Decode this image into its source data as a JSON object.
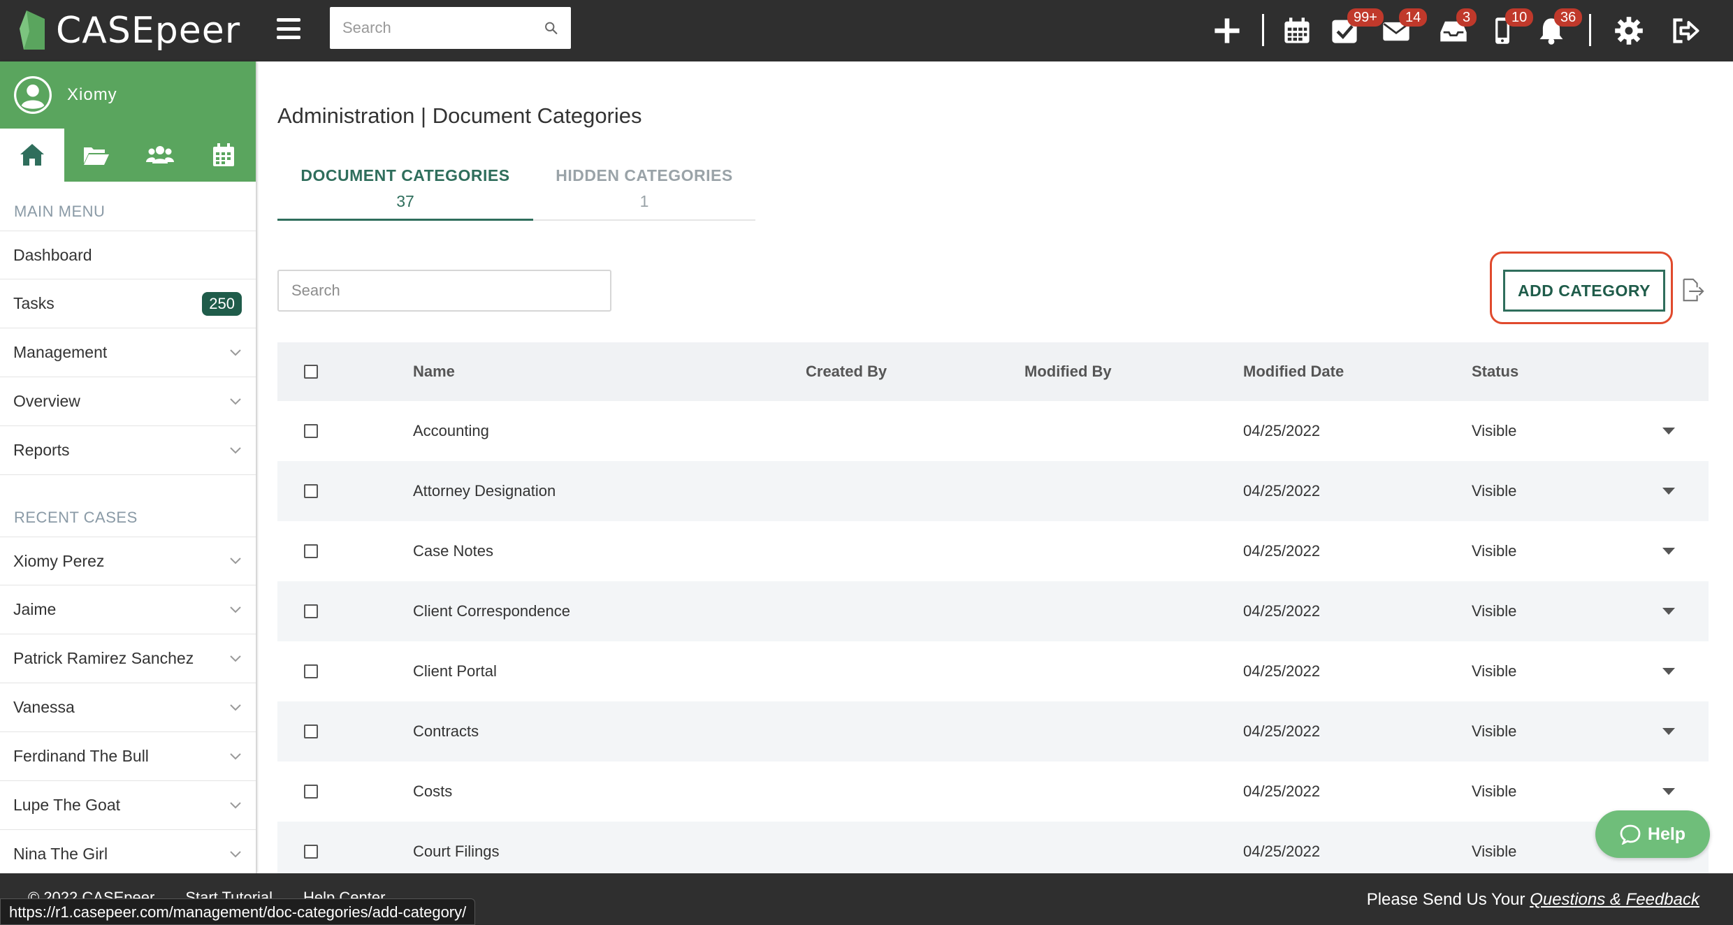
{
  "app": {
    "logo_text": "CASEpeer",
    "search_placeholder": "Search"
  },
  "topbar": {
    "badges": {
      "tasks": "99+",
      "mail": "14",
      "inbox": "3",
      "phone": "10",
      "notifications": "36"
    }
  },
  "sidebar": {
    "user_name": "Xiomy",
    "main_menu_label": "MAIN MENU",
    "menu": {
      "dashboard": "Dashboard",
      "tasks": "Tasks",
      "tasks_count": "250",
      "management": "Management",
      "overview": "Overview",
      "reports": "Reports"
    },
    "recent_cases_label": "RECENT CASES",
    "recent_cases": [
      "Xiomy Perez",
      "Jaime",
      "Patrick Ramirez Sanchez",
      "Vanessa",
      "Ferdinand The Bull",
      "Lupe The Goat",
      "Nina The Girl"
    ]
  },
  "main": {
    "page_title": "Administration | Document Categories",
    "tabs": [
      {
        "label": "DOCUMENT CATEGORIES",
        "count": "37"
      },
      {
        "label": "HIDDEN CATEGORIES",
        "count": "1"
      }
    ],
    "search_placeholder": "Search",
    "add_button": "ADD CATEGORY",
    "table": {
      "headers": {
        "name": "Name",
        "created_by": "Created By",
        "modified_by": "Modified By",
        "modified_date": "Modified Date",
        "status": "Status"
      },
      "rows": [
        {
          "name": "Accounting",
          "created_by": "",
          "modified_by": "",
          "modified_date": "04/25/2022",
          "status": "Visible"
        },
        {
          "name": "Attorney Designation",
          "created_by": "",
          "modified_by": "",
          "modified_date": "04/25/2022",
          "status": "Visible"
        },
        {
          "name": "Case Notes",
          "created_by": "",
          "modified_by": "",
          "modified_date": "04/25/2022",
          "status": "Visible"
        },
        {
          "name": "Client Correspondence",
          "created_by": "",
          "modified_by": "",
          "modified_date": "04/25/2022",
          "status": "Visible"
        },
        {
          "name": "Client Portal",
          "created_by": "",
          "modified_by": "",
          "modified_date": "04/25/2022",
          "status": "Visible"
        },
        {
          "name": "Contracts",
          "created_by": "",
          "modified_by": "",
          "modified_date": "04/25/2022",
          "status": "Visible"
        },
        {
          "name": "Costs",
          "created_by": "",
          "modified_by": "",
          "modified_date": "04/25/2022",
          "status": "Visible"
        },
        {
          "name": "Court Filings",
          "created_by": "",
          "modified_by": "",
          "modified_date": "04/25/2022",
          "status": "Visible"
        }
      ]
    },
    "help_label": "Help"
  },
  "footer": {
    "copyright": "© 2022 CASEpeer",
    "tutorial": "Start Tutorial",
    "help_center": "Help Center",
    "feedback_prefix": "Please Send Us Your ",
    "feedback_link": "Questions & Feedback"
  },
  "status_bar_url": "https://r1.casepeer.com/management/doc-categories/add-category/",
  "colors": {
    "topbar": "#2f2f2f",
    "sidebar_green": "#5aa55e",
    "accent_dark_green": "#2f6e5c",
    "badge_red": "#c0392b",
    "highlight_red": "#e04a2d",
    "help_green": "#6fbe7a"
  },
  "icons": {
    "topbar": [
      "plus-icon",
      "calendar-icon",
      "tasks-check-icon",
      "mail-icon",
      "inbox-icon",
      "phone-icon",
      "bell-icon",
      "gear-icon",
      "logout-icon"
    ],
    "sidebar_tabs": [
      "home-icon",
      "folder-open-icon",
      "users-icon",
      "calendar-icon"
    ]
  }
}
